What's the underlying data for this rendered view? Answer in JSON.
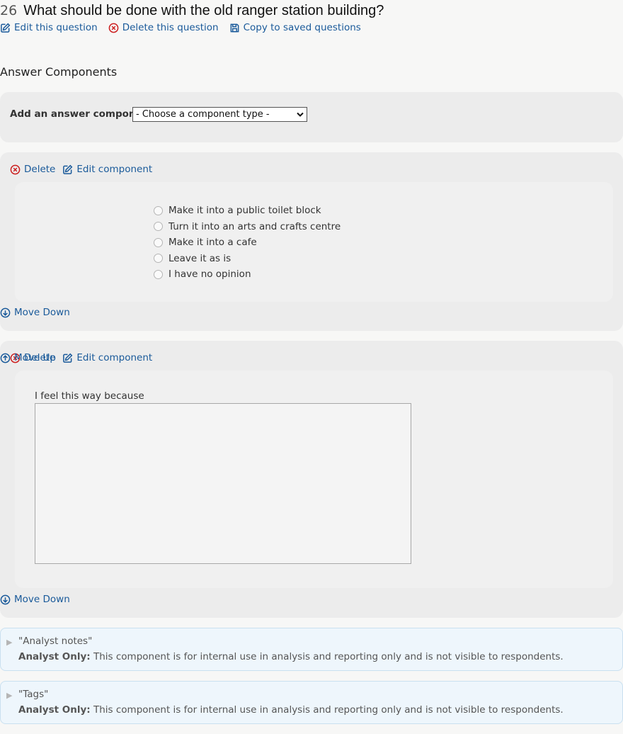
{
  "question": {
    "number": "26",
    "title": "What should be done with the old ranger station building?",
    "actions": {
      "edit": "Edit this question",
      "delete": "Delete this question",
      "copy": "Copy to saved questions"
    }
  },
  "section_title": "Answer Components",
  "add_component": {
    "label": "Add an answer component:",
    "selected": "- Choose a component type -"
  },
  "component1": {
    "delete": "Delete",
    "edit": "Edit component",
    "options": [
      "Make it into a public toilet block",
      "Turn it into an arts and crafts centre",
      "Make it into a cafe",
      "Leave it as is",
      "I have no opinion"
    ],
    "move_down": "Move Down"
  },
  "component2": {
    "delete": "Delete",
    "edit": "Edit component",
    "move_up": "Move Up",
    "prompt": "I feel this way because",
    "textarea_value": "",
    "move_down": "Move Down"
  },
  "notes": [
    {
      "title": "\"Analyst notes\"",
      "label": "Analyst Only:",
      "text": "This component is for internal use in analysis and reporting only and is not visible to respondents."
    },
    {
      "title": "\"Tags\"",
      "label": "Analyst Only:",
      "text": "This component is for internal use in analysis and reporting only and is not visible to respondents."
    }
  ],
  "colors": {
    "link": "#1a5a9a",
    "delete_icon": "#cc1f1f",
    "panel": "#ececec",
    "note_bg": "#eef6fc"
  },
  "icons": [
    "edit-icon",
    "delete-icon",
    "save-icon",
    "arrow-down-circle-icon",
    "arrow-up-circle-icon",
    "triangle-right-icon"
  ]
}
